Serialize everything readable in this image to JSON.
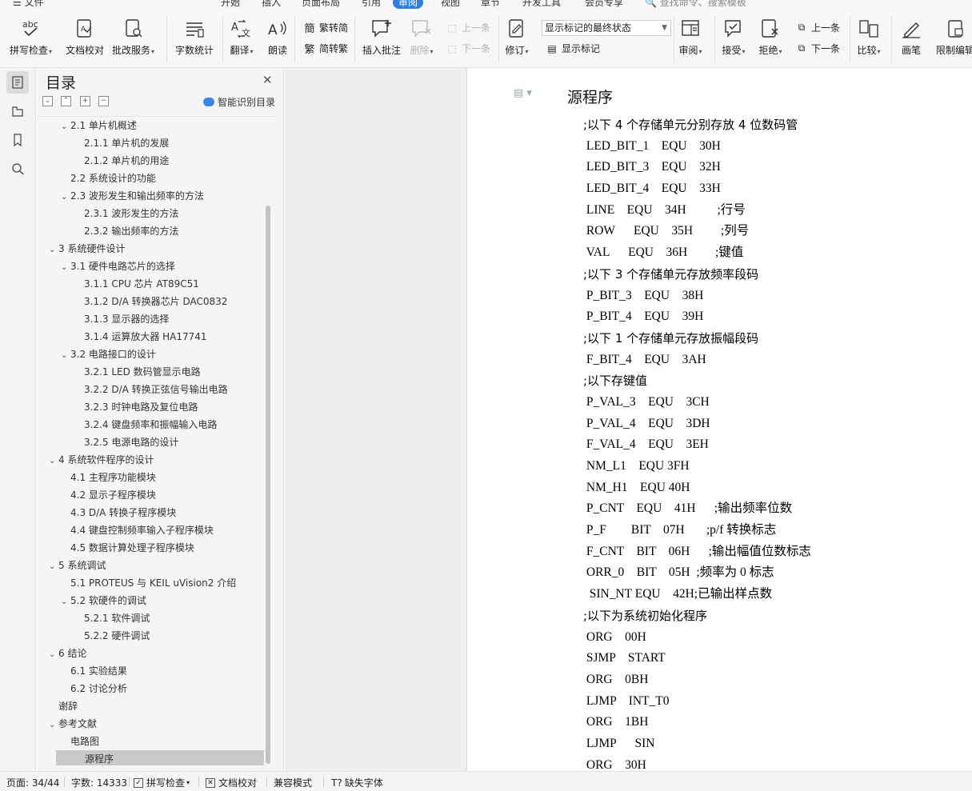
{
  "menu": {
    "file": "文件",
    "tabs": [
      "开始",
      "插入",
      "页面布局",
      "引用",
      "审阅",
      "视图",
      "章节",
      "开发工具",
      "会员专享"
    ],
    "active_tab": "审阅",
    "search_placeholder": "查找命令、搜索模板"
  },
  "ribbon": {
    "spell_check": "拼写检查",
    "doc_proof": "文档校对",
    "revise_service": "批改服务",
    "word_count": "字数统计",
    "translate": "翻译",
    "read_aloud": "朗读",
    "trad_to_simp": "繁转简",
    "simp_to_trad": "简转繁",
    "insert_comment": "插入批注",
    "delete": "删除",
    "prev_comment": "上一条",
    "next_comment": "下一条",
    "track_changes": "修订",
    "markup_state": "显示标记的最终状态",
    "show_markup": "显示标记",
    "review": "审阅",
    "accept": "接受",
    "reject": "拒绝",
    "prev_change": "上一条",
    "next_change": "下一条",
    "compare": "比较",
    "ink": "画笔",
    "restrict_edit": "限制编辑"
  },
  "colors": {
    "accent": "#2f7fe0",
    "selected_row": "#c9c9c9"
  },
  "toc": {
    "title": "目录",
    "smart_label": "智能识别目录",
    "items": [
      {
        "text": "2.1  单片机概述",
        "level": 2,
        "exp": "⌄"
      },
      {
        "text": "2.1.1  单片机的发展",
        "level": 3,
        "exp": ""
      },
      {
        "text": "2.1.2  单片机的用途",
        "level": 3,
        "exp": ""
      },
      {
        "text": "2.2 系统设计的功能",
        "level": 2,
        "exp": ""
      },
      {
        "text": "2.3  波形发生和输出频率的方法",
        "level": 2,
        "exp": "⌄"
      },
      {
        "text": "2.3.1  波形发生的方法",
        "level": 3,
        "exp": ""
      },
      {
        "text": "2.3.2  输出频率的方法",
        "level": 3,
        "exp": ""
      },
      {
        "text": "3  系统硬件设计",
        "level": 1,
        "exp": "⌄"
      },
      {
        "text": "3.1  硬件电路芯片的选择",
        "level": 2,
        "exp": "⌄"
      },
      {
        "text": "3.1.1 CPU 芯片  AT89C51",
        "level": 3,
        "exp": ""
      },
      {
        "text": "3.1.2 D/A 转换器芯片 DAC0832",
        "level": 3,
        "exp": ""
      },
      {
        "text": "3.1.3  显示器的选择",
        "level": 3,
        "exp": ""
      },
      {
        "text": "3.1.4  运算放大器 HA17741",
        "level": 3,
        "exp": ""
      },
      {
        "text": "3.2  电路接口的设计",
        "level": 2,
        "exp": "⌄"
      },
      {
        "text": "3.2.1 LED 数码管显示电路",
        "level": 3,
        "exp": ""
      },
      {
        "text": "3.2.2 D/A 转换正弦信号输出电路",
        "level": 3,
        "exp": ""
      },
      {
        "text": "3.2.3  时钟电路及复位电路",
        "level": 3,
        "exp": ""
      },
      {
        "text": "3.2.4 键盘频率和振幅输入电路",
        "level": 3,
        "exp": ""
      },
      {
        "text": "3.2.5  电源电路的设计",
        "level": 3,
        "exp": ""
      },
      {
        "text": "4  系统软件程序的设计",
        "level": 1,
        "exp": "⌄"
      },
      {
        "text": "4.1  主程序功能模块",
        "level": 2,
        "exp": ""
      },
      {
        "text": "4.2  显示子程序模块",
        "level": 2,
        "exp": ""
      },
      {
        "text": "4.3    D/A 转换子程序模块",
        "level": 2,
        "exp": ""
      },
      {
        "text": "4.4 键盘控制频率输入子程序模块",
        "level": 2,
        "exp": ""
      },
      {
        "text": "4.5  数据计算处理子程序模块",
        "level": 2,
        "exp": ""
      },
      {
        "text": "5  系统调试",
        "level": 1,
        "exp": "⌄"
      },
      {
        "text": "5.1 PROTEUS 与 KEIL uVision2 介绍",
        "level": 2,
        "exp": ""
      },
      {
        "text": "5.2  软硬件的调试",
        "level": 2,
        "exp": "⌄"
      },
      {
        "text": "5.2.1  软件调试",
        "level": 3,
        "exp": ""
      },
      {
        "text": "5.2.2  硬件调试",
        "level": 3,
        "exp": ""
      },
      {
        "text": "6  结论",
        "level": 1,
        "exp": "⌄"
      },
      {
        "text": "6.1 实验结果",
        "level": 2,
        "exp": ""
      },
      {
        "text": "6.2  讨论分析",
        "level": 2,
        "exp": ""
      },
      {
        "text": "谢辞",
        "level": 1,
        "exp": ""
      },
      {
        "text": "参考文献",
        "level": 1,
        "exp": "⌄"
      },
      {
        "text": "电路图",
        "level": 2,
        "exp": ""
      },
      {
        "text": "源程序",
        "level": 2,
        "exp": "",
        "selected": true
      }
    ]
  },
  "document": {
    "heading": "源程序",
    "lines": [
      {
        "t": ";以下 4 个存储单元分别存放 4 位数码管",
        "c": true
      },
      {
        "t": " LED_BIT_1    EQU    30H"
      },
      {
        "t": " LED_BIT_3    EQU    32H"
      },
      {
        "t": " LED_BIT_4    EQU    33H"
      },
      {
        "t": " LINE    EQU    34H          ;行号"
      },
      {
        "t": " ROW      EQU    35H         ;列号"
      },
      {
        "t": " VAL      EQU    36H         ;键值"
      },
      {
        "t": ";以下 3 个存储单元存放频率段码",
        "c": true
      },
      {
        "t": " P_BIT_3    EQU    38H"
      },
      {
        "t": " P_BIT_4    EQU    39H"
      },
      {
        "t": ";以下 1 个存储单元存放振幅段码",
        "c": true
      },
      {
        "t": " F_BIT_4    EQU    3AH"
      },
      {
        "t": ";以下存键值",
        "c": true
      },
      {
        "t": " P_VAL_3    EQU    3CH"
      },
      {
        "t": " P_VAL_4    EQU    3DH"
      },
      {
        "t": " F_VAL_4    EQU    3EH"
      },
      {
        "t": " NM_L1    EQU 3FH"
      },
      {
        "t": " NM_H1    EQU 40H"
      },
      {
        "t": " P_CNT    EQU    41H      ;输出频率位数"
      },
      {
        "t": " P_F        BIT    07H       ;p/f 转换标志"
      },
      {
        "t": " F_CNT    BIT    06H      ;输出幅值位数标志"
      },
      {
        "t": " ORR_0    BIT    05H  ;频率为 0 标志"
      },
      {
        "t": "  SIN_NT EQU    42H;已输出样点数"
      },
      {
        "t": ";以下为系统初始化程序",
        "c": true
      },
      {
        "t": " ORG    00H"
      },
      {
        "t": " SJMP    START"
      },
      {
        "t": " ORG    0BH"
      },
      {
        "t": " LJMP    INT_T0"
      },
      {
        "t": " ORG    1BH"
      },
      {
        "t": " LJMP      SIN"
      },
      {
        "t": " ORG    30H"
      }
    ]
  },
  "status": {
    "page": "页面: 34/44",
    "words": "字数: 14333",
    "spell": "拼写检查",
    "proof": "文档校对",
    "compat": "兼容模式",
    "missing_font": "缺失字体"
  }
}
